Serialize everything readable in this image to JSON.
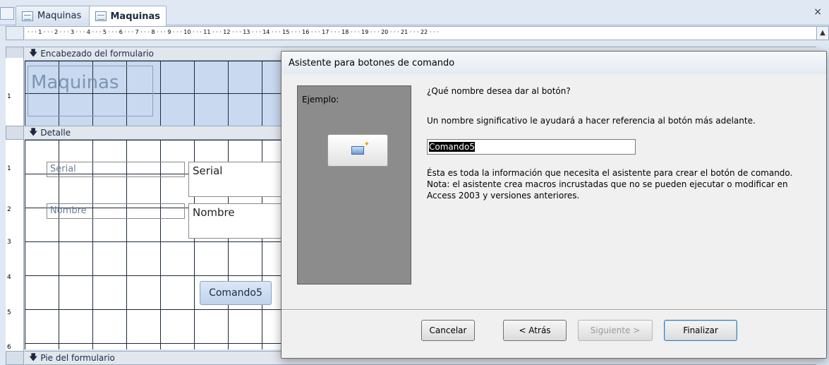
{
  "tabs": [
    {
      "label": "Maquinas",
      "active": false
    },
    {
      "label": "Maquinas",
      "active": true
    }
  ],
  "close_glyph": "×",
  "ruler": {
    "h_labels": [
      "· · · 1 · · · 2 · · · 3 · · · 4 · · · 5 · · · 6 · · · 7 · · · 8 · · · 9 · · · 10 · · · 11 · · · 12 · · · 13 · · · 14 · · · 15 · · · 16 · · · 17 · · · 18 · · · 19 · · · 20 · · · 21 · · · 22 · · ·"
    ],
    "v_labels": [
      "1",
      "1",
      "2",
      "3",
      "4",
      "5",
      "6"
    ]
  },
  "form": {
    "header_section": "Encabezado del formulario",
    "detail_section": "Detalle",
    "footer_section": "Pie del formulario",
    "title": "Maquinas",
    "label_serial": "Serial",
    "text_serial": "Serial",
    "label_nombre": "Nombre",
    "text_nombre": "Nombre",
    "command_button": "Comando5"
  },
  "dialog": {
    "title": "Asistente para botones de comando",
    "example_label": "Ejemplo:",
    "question": "¿Qué nombre desea dar al botón?",
    "description": "Un nombre significativo le ayudará a hacer referencia al botón más adelante.",
    "name_value": "Comando5",
    "info_line1": "Ésta es toda la información que necesita el asistente para crear el botón de comando.",
    "info_line2": "Nota: el asistente crea macros incrustadas que no se pueden ejecutar o modificar en Access 2003 y versiones anteriores.",
    "buttons": {
      "cancel": "Cancelar",
      "back": "< Atrás",
      "next": "Siguiente >",
      "finish": "Finalizar"
    }
  },
  "colors": {
    "header_fill": "#c9d9ef",
    "dialog_bg": "#f0f0f0",
    "example_panel": "#8c8c8c"
  }
}
